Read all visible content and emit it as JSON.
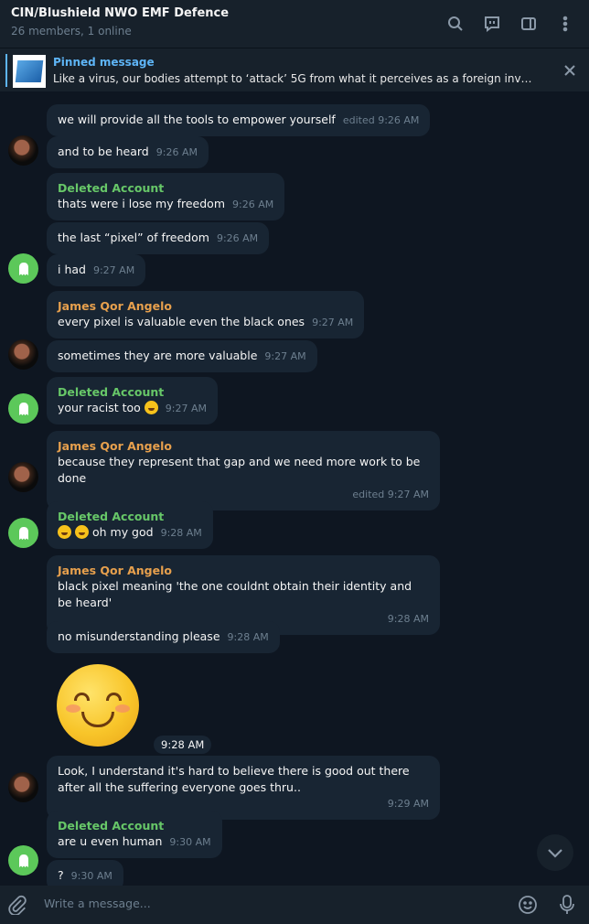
{
  "header": {
    "title": "CIN/Blushield NWO EMF Defence",
    "subtitle": "26 members, 1 online",
    "icons": [
      "search-icon",
      "chat-bubble-icon",
      "sidebar-icon",
      "more-vertical-icon"
    ]
  },
  "pinned": {
    "title": "Pinned message",
    "text": "Like a virus, our bodies attempt to ‘attack’ 5G from what it perceives as a foreign invade..."
  },
  "messages": [
    {
      "text": "we will provide all the tools to empower yourself",
      "time": "edited 9:26 AM"
    },
    {
      "text": "and to be heard",
      "time": "9:26 AM"
    },
    {
      "sender": "Deleted Account",
      "text": "thats were i lose my freedom",
      "time": "9:26 AM"
    },
    {
      "text": "the last “pixel” of freedom",
      "time": "9:26 AM"
    },
    {
      "text": "i had",
      "time": "9:27 AM"
    },
    {
      "sender": "James Qor Angelo",
      "text": "every pixel is valuable even the black ones",
      "time": "9:27 AM"
    },
    {
      "text": "sometimes they are more valuable",
      "time": "9:27 AM"
    },
    {
      "sender": "Deleted Account",
      "text": "your racist too",
      "time": "9:27 AM"
    },
    {
      "sender": "James Qor Angelo",
      "text": "because they represent that gap and we need more work to be done",
      "time": "edited 9:27 AM"
    },
    {
      "sender": "Deleted Account",
      "text": "oh my god",
      "time": "9:28 AM"
    },
    {
      "sender": "James Qor Angelo",
      "text": "black pixel meaning 'the one couldnt obtain their identity and be heard'",
      "time": "9:28 AM"
    },
    {
      "text": "no misunderstanding please",
      "time": "9:28 AM"
    },
    {
      "time": "9:28 AM"
    },
    {
      "text": "Look, I understand it's hard to believe there is good out there after all the suffering everyone goes thru..",
      "time": "9:29 AM"
    },
    {
      "sender": "Deleted Account",
      "text": "are u even human",
      "time": "9:30 AM"
    },
    {
      "text": "?",
      "time": "9:30 AM"
    }
  ],
  "composer": {
    "placeholder": "Write a message..."
  },
  "colors": {
    "background": "#0e1621",
    "panel": "#17212b",
    "bubble": "#182533",
    "accent": "#5eb5f7",
    "deleted_account": "#67c768",
    "james": "#e7a04d"
  }
}
